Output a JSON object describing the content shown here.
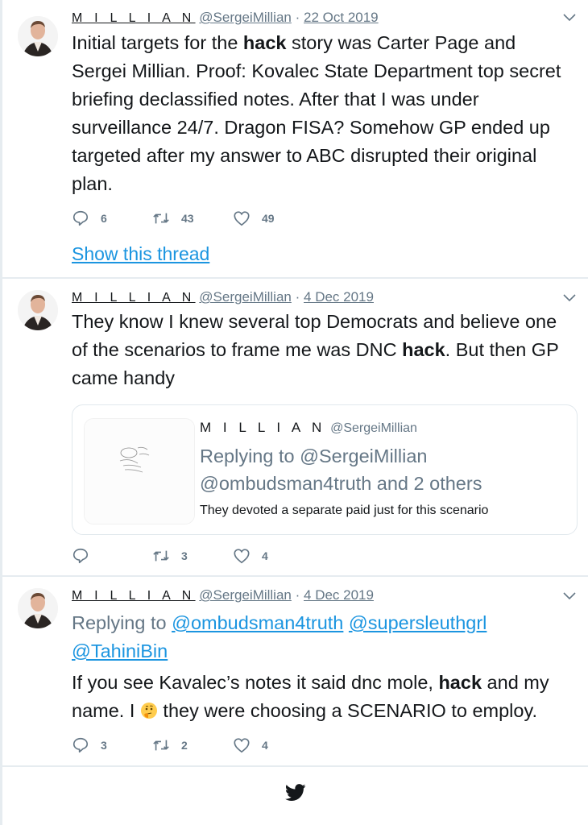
{
  "tweets": [
    {
      "display_name": "M I L L I A N",
      "handle": "@SergeiMillian",
      "separator": "·",
      "date": "22 Oct 2019",
      "text_before": "Initial targets for the ",
      "text_bold": "hack",
      "text_after": " story was Carter Page and Sergei Millian. Proof: Kovalec State Department top secret briefing declassified notes. After that I was under surveillance 24/7. Dragon FISA? Somehow GP ended up targeted after my answer to ABC disrupted their original plan.",
      "reply_count": "6",
      "retweet_count": "43",
      "like_count": "49",
      "show_thread_label": "Show this thread"
    },
    {
      "display_name": "M I L L I A N",
      "handle": "@SergeiMillian",
      "separator": "·",
      "date": "4 Dec 2019",
      "text_before": "They know I knew several top Democrats and believe one of the scenarios to frame me was DNC ",
      "text_bold": "hack",
      "text_after": ". But then GP came handy",
      "quoted": {
        "display_name": "M I L L I A N",
        "handle": "@SergeiMillian",
        "replying_to": "Replying to @SergeiMillian @ombudsman4truth and 2 others",
        "text": "They devoted a separate paid just for this scenario"
      },
      "reply_count": "",
      "retweet_count": "3",
      "like_count": "4"
    },
    {
      "display_name": "M I L L I A N",
      "handle": "@SergeiMillian",
      "separator": "·",
      "date": "4 Dec 2019",
      "replying_label": "Replying to ",
      "mentions": [
        "@ombudsman4truth",
        "@supersleuthgrl",
        "@TahiniBin"
      ],
      "text_before": "If you see Kavalec’s notes it said dnc mole, ",
      "text_bold": "hack",
      "text_mid": " and my name. I ",
      "emoji": "thinking-face",
      "text_after": " they were choosing a SCENARIO to employ.",
      "reply_count": "3",
      "retweet_count": "2",
      "like_count": "4"
    }
  ],
  "footer": {
    "icon": "twitter-bird-icon"
  },
  "colors": {
    "link": "#1b95e0",
    "muted": "#657786",
    "text": "#14171a",
    "divider": "#e6ecf0"
  }
}
